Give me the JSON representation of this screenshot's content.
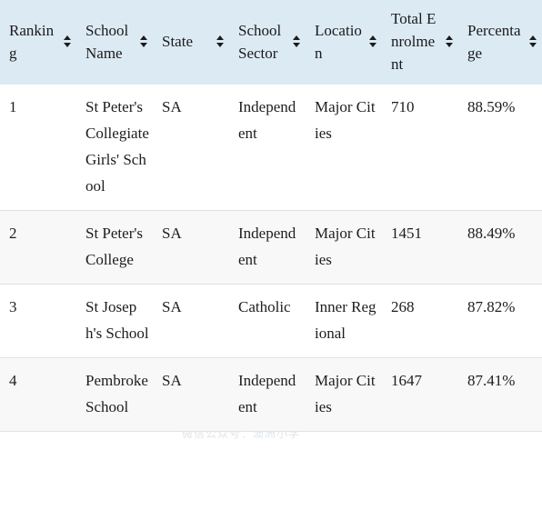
{
  "table": {
    "columns": [
      {
        "label": "Ranking",
        "sort_icon": "sort-updown-icon",
        "key": "ranking"
      },
      {
        "label": "School Name",
        "sort_icon": "sort-updown-icon",
        "key": "school_name"
      },
      {
        "label": "State",
        "sort_icon": "sort-updown-icon",
        "key": "state"
      },
      {
        "label": "School Sector",
        "sort_icon": "sort-updown-icon",
        "key": "school_sector"
      },
      {
        "label": "Location",
        "sort_icon": "sort-updown-icon",
        "key": "location"
      },
      {
        "label": "Total Enrolment",
        "sort_icon": "sort-updown-icon",
        "key": "total_enrolment"
      },
      {
        "label": "Percentage",
        "sort_icon": "sort-updown-icon",
        "key": "percentage"
      }
    ],
    "rows": [
      {
        "ranking": "1",
        "school_name": "St Peter's Collegiate Girls' School",
        "state": "SA",
        "school_sector": "Independent",
        "location": "Major Cities",
        "total_enrolment": "710",
        "percentage": "88.59%"
      },
      {
        "ranking": "2",
        "school_name": "St Peter's College",
        "state": "SA",
        "school_sector": "Independent",
        "location": "Major Cities",
        "total_enrolment": "1451",
        "percentage": "88.49%"
      },
      {
        "ranking": "3",
        "school_name": "St Joseph's School",
        "state": "SA",
        "school_sector": "Catholic",
        "location": "Inner Regional",
        "total_enrolment": "268",
        "percentage": "87.82%"
      },
      {
        "ranking": "4",
        "school_name": "Pembroke School",
        "state": "SA",
        "school_sector": "Independent",
        "location": "Major Cities",
        "total_enrolment": "1647",
        "percentage": "87.41%"
      }
    ]
  },
  "watermarks": {
    "logo_text": "澳洲小学",
    "caption": "微信公众号：澳洲小学"
  },
  "colors": {
    "header_background": "#dceaf4",
    "row_even_background": "#f8f8f8",
    "row_odd_background": "#ffffff",
    "row_border": "#e2e2e2",
    "text": "#1d1d1d",
    "watermark_logo": "#ccd8e4",
    "watermark_caption": "#dfe4ea",
    "watermark_pencil": "#f2d7d7",
    "watermark_ruler": "#f6eed4"
  }
}
